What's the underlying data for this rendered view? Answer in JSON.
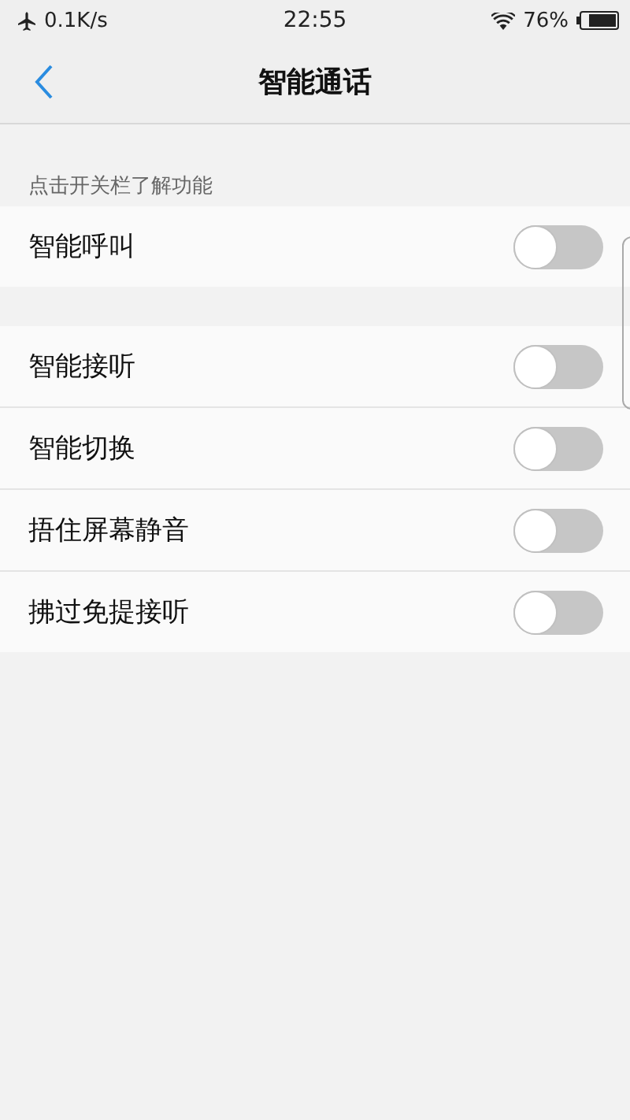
{
  "status_bar": {
    "speed": "0.1K/s",
    "time": "22:55",
    "battery": "76%"
  },
  "nav": {
    "title": "智能通话"
  },
  "sections": [
    {
      "header": "点击开关栏了解功能",
      "items": [
        {
          "label": "智能呼叫",
          "on": false
        }
      ]
    },
    {
      "items": [
        {
          "label": "智能接听",
          "on": false
        },
        {
          "label": "智能切换",
          "on": false
        },
        {
          "label": "捂住屏幕静音",
          "on": false
        },
        {
          "label": "拂过免提接听",
          "on": false
        }
      ]
    }
  ]
}
